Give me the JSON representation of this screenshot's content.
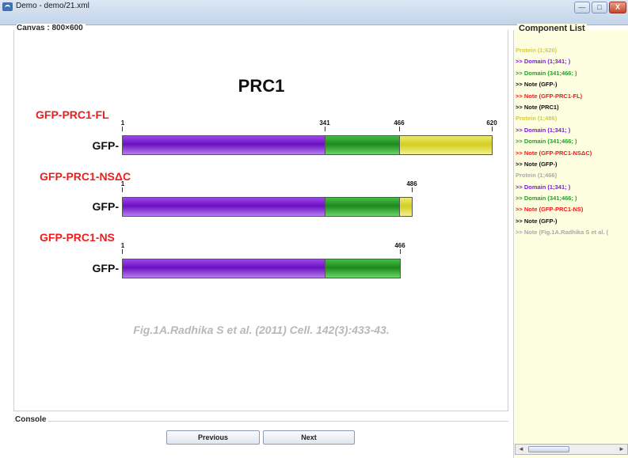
{
  "window": {
    "title": "Demo - demo/21.xml",
    "minimize": "—",
    "maximize": "□",
    "close": "X"
  },
  "canvas": {
    "label": "Canvas : 800×600",
    "title": "PRC1",
    "citation": "Fig.1A.Radhika S et al. (2011) Cell. 142(3):433-43."
  },
  "constructs": [
    {
      "name": "GFP-PRC1-FL",
      "prefix": "GFP-",
      "ticks": [
        "1",
        "341",
        "466",
        "620"
      ],
      "segments": [
        {
          "start": 1,
          "end": 341,
          "color": "purple"
        },
        {
          "start": 341,
          "end": 466,
          "color": "green"
        },
        {
          "start": 466,
          "end": 620,
          "color": "yellow"
        }
      ]
    },
    {
      "name": "GFP-PRC1-NSΔC",
      "prefix": "GFP-",
      "ticks": [
        "1",
        "486"
      ],
      "segments": [
        {
          "start": 1,
          "end": 341,
          "color": "purple"
        },
        {
          "start": 341,
          "end": 466,
          "color": "green"
        },
        {
          "start": 466,
          "end": 486,
          "color": "yellow"
        }
      ]
    },
    {
      "name": "GFP-PRC1-NS",
      "prefix": "GFP-",
      "ticks": [
        "1",
        "466"
      ],
      "segments": [
        {
          "start": 1,
          "end": 341,
          "color": "purple"
        },
        {
          "start": 341,
          "end": 466,
          "color": "green"
        }
      ]
    }
  ],
  "colors": {
    "purple": "#8a2be2",
    "green": "#2ea02e",
    "yellow": "#e2dc3a",
    "red": "#ee1c1c",
    "gray": "#a9a9a9"
  },
  "console": {
    "label": "Console",
    "previous": "Previous",
    "next": "Next"
  },
  "component_list": {
    "title": "Component List",
    "items": [
      {
        "text": "Protein (1;620)",
        "color": "#d9cf2b"
      },
      {
        "text": ">> Domain (1;341; )",
        "color": "#7a1fd4"
      },
      {
        "text": ">> Domain (341;466; )",
        "color": "#2e9a2e"
      },
      {
        "text": ">> Note (GFP-)",
        "color": "#111111"
      },
      {
        "text": ">> Note (GFP-PRC1-FL)",
        "color": "#ee1c1c"
      },
      {
        "text": ">> Note (PRC1)",
        "color": "#111111"
      },
      {
        "text": "Protein (1;486)",
        "color": "#d9cf2b"
      },
      {
        "text": ">> Domain (1;341; )",
        "color": "#7a1fd4"
      },
      {
        "text": ">> Domain (341;466; )",
        "color": "#2e9a2e"
      },
      {
        "text": ">> Note (GFP-PRC1-NSΔC)",
        "color": "#ee1c1c"
      },
      {
        "text": ">> Note (GFP-)",
        "color": "#111111"
      },
      {
        "text": "Protein (1;466)",
        "color": "#a9a9a9"
      },
      {
        "text": ">> Domain (1;341; )",
        "color": "#7a1fd4"
      },
      {
        "text": ">> Domain (341;466; )",
        "color": "#2e9a2e"
      },
      {
        "text": ">> Note (GFP-PRC1-NS)",
        "color": "#ee1c1c"
      },
      {
        "text": ">> Note (GFP-)",
        "color": "#111111"
      },
      {
        "text": ">> Note (Fig.1A.Radhika S et al. (",
        "color": "#a9a9a9"
      }
    ]
  },
  "scrollbar": {
    "left_arrow": "◄",
    "right_arrow": "►"
  }
}
